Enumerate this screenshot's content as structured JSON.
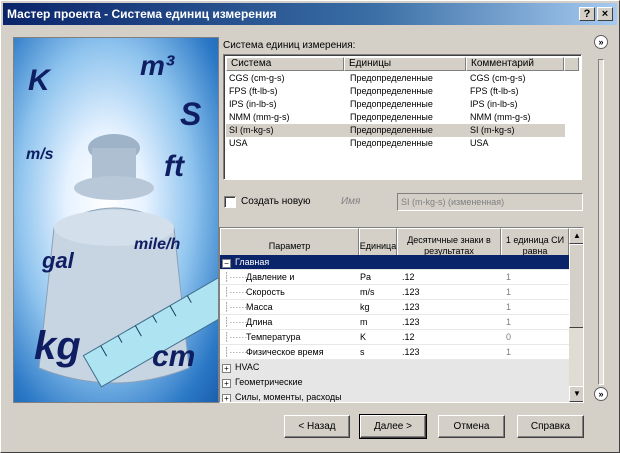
{
  "window": {
    "title": "Мастер проекта - Система единиц измерения",
    "help_label": "?",
    "close_label": "×"
  },
  "picture": {
    "units": [
      "K",
      "m³",
      "S",
      "m/s",
      "ft",
      "mile/h",
      "gal",
      "kg",
      "cm"
    ]
  },
  "systems": {
    "label": "Система единиц измерения:",
    "columns": [
      "Система",
      "Единицы",
      "Комментарий"
    ],
    "rows": [
      {
        "system": "CGS (cm-g-s)",
        "units": "Предопределенные",
        "comment": "CGS (cm-g-s)"
      },
      {
        "system": "FPS (ft-lb-s)",
        "units": "Предопределенные",
        "comment": "FPS (ft-lb-s)"
      },
      {
        "system": "IPS (in-lb-s)",
        "units": "Предопределенные",
        "comment": "IPS (in-lb-s)"
      },
      {
        "system": "NMM (mm-g-s)",
        "units": "Предопределенные",
        "comment": "NMM (mm-g-s)"
      },
      {
        "system": "SI (m-kg-s)",
        "units": "Предопределенные",
        "comment": "SI (m-kg-s)"
      },
      {
        "system": "USA",
        "units": "Предопределенные",
        "comment": "USA"
      }
    ]
  },
  "create_new": {
    "label": "Создать новую",
    "name_label": "Имя",
    "name_value": "SI (m-kg-s) (измененная)"
  },
  "params": {
    "columns": [
      "Параметр",
      "Единица",
      "Десятичные знаки в результатах",
      "1 единица СИ равна"
    ],
    "categories": [
      {
        "label": "Главная",
        "toggle": "−"
      },
      {
        "label": "HVAC",
        "toggle": "+"
      },
      {
        "label": "Геометрические",
        "toggle": "+"
      },
      {
        "label": "Силы, моменты, расходы",
        "toggle": "+"
      }
    ],
    "rows": [
      {
        "name": "Давление и",
        "unit": "Pa",
        "decimals": ".12",
        "si": "1"
      },
      {
        "name": "Скорость",
        "unit": "m/s",
        "decimals": ".123",
        "si": "1"
      },
      {
        "name": "Масса",
        "unit": "kg",
        "decimals": ".123",
        "si": "1"
      },
      {
        "name": "Длина",
        "unit": "m",
        "decimals": ".123",
        "si": "1"
      },
      {
        "name": "Температура",
        "unit": "K",
        "decimals": ".12",
        "si": "0"
      },
      {
        "name": "Физическое время",
        "unit": "s",
        "decimals": ".123",
        "si": "1"
      }
    ]
  },
  "buttons": {
    "back": "< Назад",
    "next": "Далее >",
    "cancel": "Отмена",
    "help": "Справка"
  },
  "colors": {
    "title_bar": "#0a246a",
    "selection": "#0a246a",
    "face": "#d4d0c8"
  },
  "icons": {
    "scroll_up": "▲",
    "scroll_down": "▼",
    "chevron": "»"
  }
}
